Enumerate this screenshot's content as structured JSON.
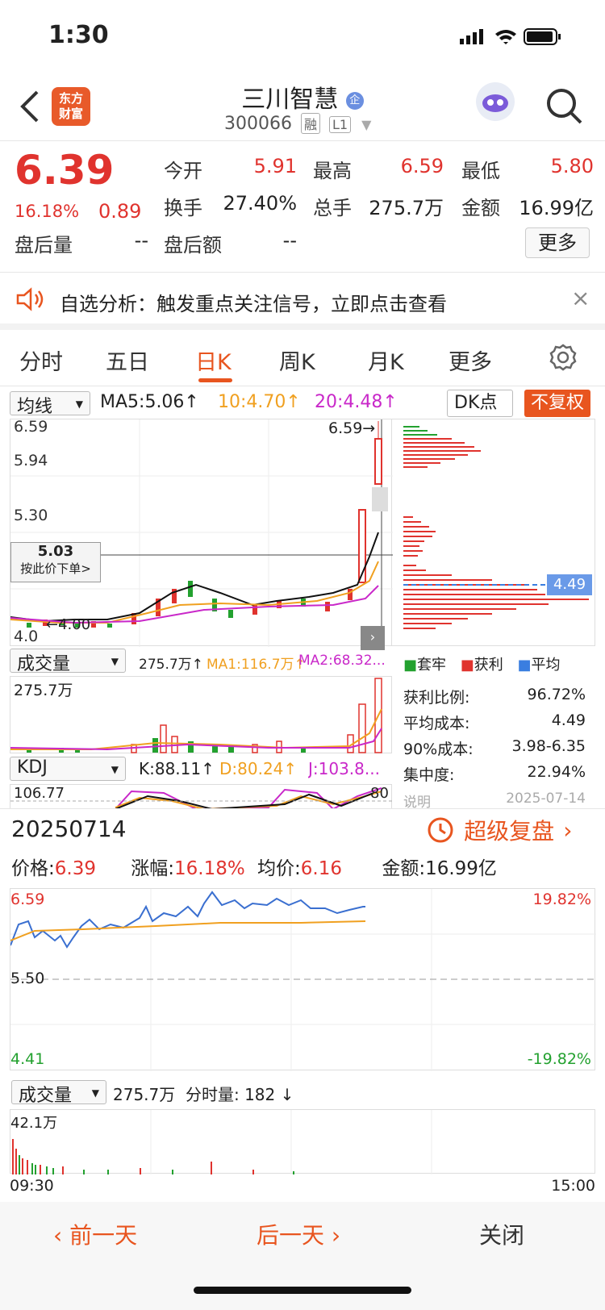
{
  "status": {
    "time": "1:30"
  },
  "header": {
    "logo": "东方财富",
    "title": "三川智慧",
    "badge": "企",
    "code": "300066",
    "tag1": "融",
    "tag2": "L1"
  },
  "quote": {
    "price": "6.39",
    "change_pct": "16.18%",
    "change": "0.89",
    "open_label": "今开",
    "open": "5.91",
    "high_label": "最高",
    "high": "6.59",
    "low_label": "最低",
    "low": "5.80",
    "turnover_label": "换手",
    "turnover": "27.40%",
    "volume_label": "总手",
    "volume": "275.7万",
    "amount_label": "金额",
    "amount": "16.99亿",
    "after_vol_label": "盘后量",
    "after_vol": "--",
    "after_amt_label": "盘后额",
    "after_amt": "--",
    "more": "更多"
  },
  "alert": {
    "text": "自选分析：触发重点关注信号，立即点击查看"
  },
  "tabs": [
    "分时",
    "五日",
    "日K",
    "周K",
    "月K",
    "更多"
  ],
  "kchart": {
    "ma_select": "均线",
    "ma5": "MA5:5.06↑",
    "ma10": "10:4.70↑",
    "ma20": "20:4.48↑",
    "dk": "DK点",
    "fuquan": "不复权",
    "y_top": "6.59",
    "y2": "5.94",
    "y3": "5.30",
    "y_bottom": "4.0",
    "high_marker": "6.59→",
    "low_marker": "←4.00",
    "cursor_price": "5.03",
    "cursor_hint": "按此价下单>",
    "avg_cost_tag": "4.49"
  },
  "chips": {
    "legend": [
      "套牢",
      "获利",
      "平均"
    ],
    "rows": [
      {
        "label": "获利比例:",
        "value": "96.72%"
      },
      {
        "label": "平均成本:",
        "value": "4.49"
      },
      {
        "label": "90%成本:",
        "value": "3.98-6.35"
      },
      {
        "label": "集中度:",
        "value": "22.94%"
      }
    ],
    "note_label": "说明",
    "note_date": "2025-07-14"
  },
  "volume": {
    "select": "成交量",
    "vol": "275.7万↑",
    "ma1": "MA1:116.7万↑",
    "ma2": "MA2:68.32...",
    "y_top": "275.7万"
  },
  "kdj": {
    "select": "KDJ",
    "k": "K:88.11↑",
    "d": "D:80.24↑",
    "j": "J:103.8...",
    "y_top": "106.77",
    "y_right": "80"
  },
  "day": {
    "date": "20250714",
    "replay": "超级复盘",
    "price_label": "价格:",
    "price": "6.39",
    "chg_label": "涨幅:",
    "chg": "16.18%",
    "avg_label": "均价:",
    "avg": "6.16",
    "amt_label": "金额:",
    "amt": "16.99亿",
    "y_top": "6.59",
    "y_mid": "5.50",
    "y_bottom": "4.41",
    "pct_top": "19.82%",
    "pct_bottom": "-19.82%",
    "vol_select": "成交量",
    "vol_text": "275.7万  分时量: 182 ↓",
    "vol_top": "42.1万",
    "t_start": "09:30",
    "t_end": "15:00"
  },
  "nav": {
    "prev": "前一天",
    "next": "后一天",
    "close": "关闭"
  },
  "colors": {
    "red": "#e0332e",
    "green": "#23a12f",
    "orange": "#e8551f"
  }
}
